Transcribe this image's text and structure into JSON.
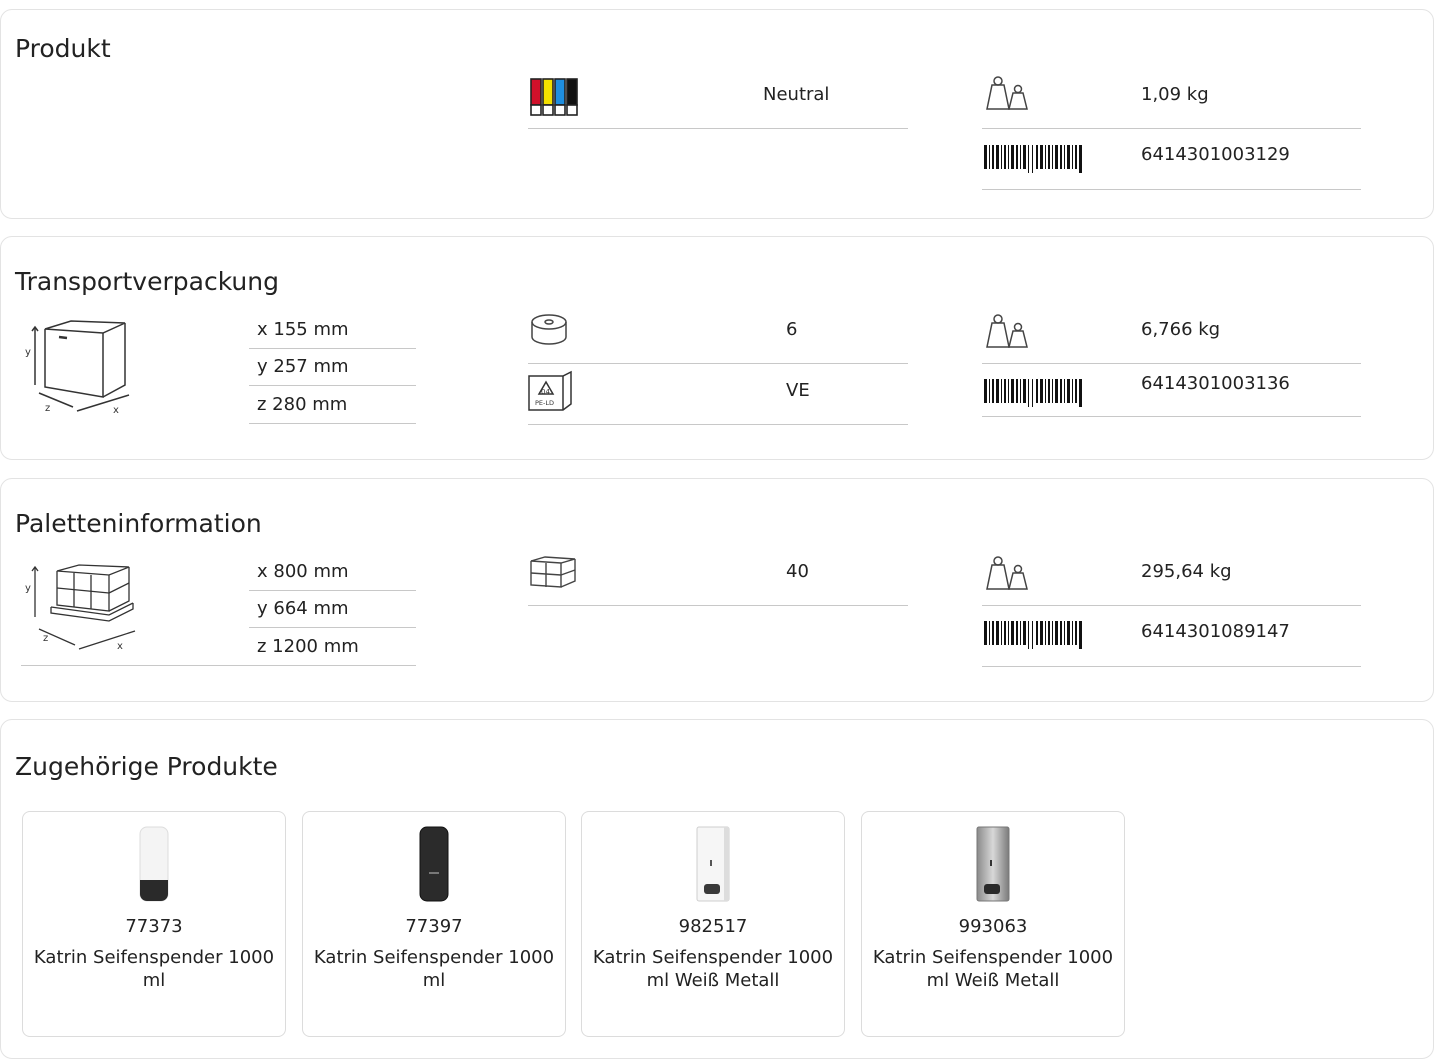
{
  "produkt": {
    "title": "Produkt",
    "color_label": "Neutral",
    "weight": "1,09 kg",
    "ean": "6414301003129",
    "icons": [
      "color-markers-icon",
      "weight-icon",
      "barcode-icon"
    ],
    "marker_colors": [
      "#d0102a",
      "#f3e000",
      "#1f8fe0",
      "#111111"
    ]
  },
  "transport": {
    "title": "Transportverpackung",
    "dims": [
      "x 155 mm",
      "y 257 mm",
      "z 280 mm"
    ],
    "quantity": "6",
    "packaging": "VE",
    "weight": "6,766 kg",
    "ean": "6414301003136",
    "icons": [
      "box-dimensions-icon",
      "roll-icon",
      "pe-ld-recycling-icon",
      "weight-icon",
      "barcode-icon"
    ]
  },
  "palette": {
    "title": "Paletteninformation",
    "dims": [
      "x 800 mm",
      "y 664 mm",
      "z 1200 mm"
    ],
    "quantity": "40",
    "weight": "295,64 kg",
    "ean": "6414301089147",
    "icons": [
      "pallet-dimensions-icon",
      "boxes-icon",
      "weight-icon",
      "barcode-icon"
    ]
  },
  "related": {
    "title": "Zugehörige Produkte",
    "items": [
      {
        "id": "77373",
        "name": "Katrin Seifenspender 1000 ml",
        "variant": "white"
      },
      {
        "id": "77397",
        "name": "Katrin Seifenspender 1000 ml",
        "variant": "black"
      },
      {
        "id": "982517",
        "name": "Katrin Seifenspender 1000 ml Weiß Metall",
        "variant": "white-metal"
      },
      {
        "id": "993063",
        "name": "Katrin Seifenspender 1000 ml Weiß Metall",
        "variant": "steel"
      }
    ]
  }
}
